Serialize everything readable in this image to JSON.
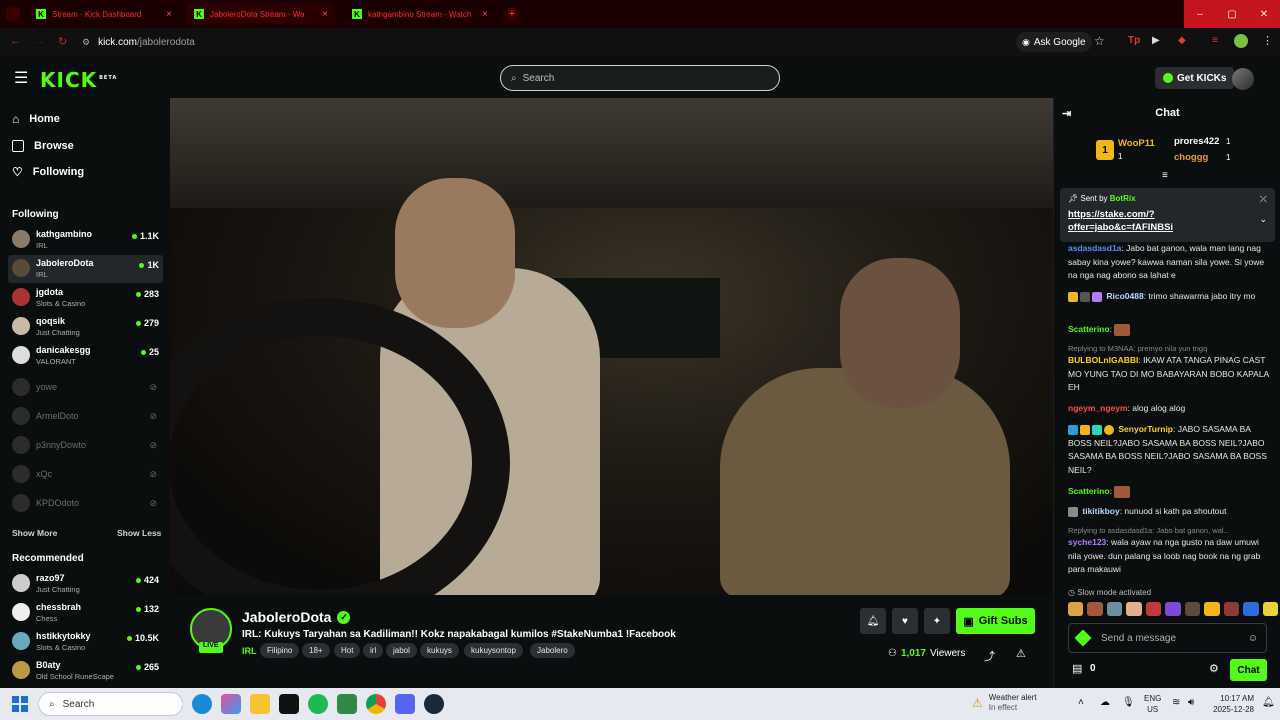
{
  "browser": {
    "tabs": [
      {
        "title": "Stream - Kick Dashboard"
      },
      {
        "title": "JaboleroDota Stream - Wa"
      },
      {
        "title": "kathgambino Stream - Watch"
      }
    ],
    "url_host": "kick.com",
    "url_path": "/jabolerodota",
    "ask_google": "Ask Google"
  },
  "header": {
    "logo": "KICK",
    "logo_badge": "BETA",
    "search_placeholder": "Search",
    "get_kicks": "Get KICKs"
  },
  "sidebar": {
    "nav": [
      {
        "label": "Home",
        "icon": "home-icon"
      },
      {
        "label": "Browse",
        "icon": "browse-icon"
      },
      {
        "label": "Following",
        "icon": "heart-icon"
      }
    ],
    "following_title": "Following",
    "following": [
      {
        "name": "kathgambino",
        "category": "IRL",
        "viewers": "1.1K"
      },
      {
        "name": "JaboleroDota",
        "category": "IRL",
        "viewers": "1K"
      },
      {
        "name": "jgdota",
        "category": "Slots & Casino",
        "viewers": "283"
      },
      {
        "name": "qoqsik",
        "category": "Just Chatting",
        "viewers": "279"
      },
      {
        "name": "danicakesgg",
        "category": "VALORANT",
        "viewers": "25"
      }
    ],
    "offline": [
      {
        "name": "yowe"
      },
      {
        "name": "ArmelDoto"
      },
      {
        "name": "p3nnyDowto"
      },
      {
        "name": "xQc"
      },
      {
        "name": "KPDOdoto"
      }
    ],
    "show_more": "Show More",
    "show_less": "Show Less",
    "recommended_title": "Recommended",
    "recommended": [
      {
        "name": "razo97",
        "category": "Just Chatting",
        "viewers": "424"
      },
      {
        "name": "chessbrah",
        "category": "Chess",
        "viewers": "132"
      },
      {
        "name": "hstikkytokky",
        "category": "Slots & Casino",
        "viewers": "10.5K"
      },
      {
        "name": "B0aty",
        "category": "Old School RuneScape",
        "viewers": "265"
      }
    ]
  },
  "stream": {
    "channel": "JaboleroDota",
    "live": "LIVE",
    "title": "IRL: Kukuys Taryahan sa Kadiliman!! Kokz napakabagal kumilos #StakeNumba1 !Facebook",
    "category": "IRL",
    "tags": [
      "Filipino",
      "18+",
      "Hot",
      "irl",
      "jabol",
      "kukuys",
      "kukuysontop",
      "Jabolero"
    ],
    "viewers": "1,017",
    "viewers_label": "Viewers",
    "gift_subs": "Gift Subs"
  },
  "chat": {
    "title": "Chat",
    "leaderboard": [
      {
        "name": "WooP11",
        "count": "1"
      },
      {
        "name": "prores422",
        "count": "1"
      },
      {
        "name": "choggg",
        "count": "1"
      }
    ],
    "pinned_sent_by": "Sent by",
    "pinned_sender": "BotRix",
    "pinned_link": "https://stake.com/?offer=jabo&c=fAFINBSi",
    "pinned_link_l1": "https://stake.com/?",
    "pinned_link_l2": "offer=jabo&c=fAFINBSi",
    "messages": [
      {
        "user": "asdasdasd1a",
        "text": "Jabo bat ganon, wala man lang nag sabay kina yowe? kawwa naman sila yowe. Si yowe na nga nag abono sa lahat e"
      },
      {
        "user": "Rico0488",
        "text": "trimo shawarma jabo itry mo"
      },
      {
        "user": "Scatterino",
        "text": ""
      },
      {
        "reply": "Replying to M3NAA: premyo nila yun tngq"
      },
      {
        "user": "BULBOLnIGABBI",
        "text": "IKAW ATA TANGA PINAG CAST MO YUNG TAO DI MO BABAYARAN BOBO KAPALA EH"
      },
      {
        "user": "ngeym_ngeym",
        "text": "alog alog alog"
      },
      {
        "user": "SenyorTurnip",
        "text": "JABO SASAMA BA BOSS NEIL?JABO SASAMA BA BOSS NEIL?JABO SASAMA BA BOSS NEIL?JABO SASAMA BA BOSS NEIL?"
      },
      {
        "user": "Scatterino",
        "text": ""
      },
      {
        "user": "tikitikboy",
        "text": "nunuod si kath pa shoutout"
      },
      {
        "reply": "Replying to asdasdasd1a: Jabo bat ganon, wal..."
      },
      {
        "user": "syche123",
        "text": "wala ayaw na nga gusto na daw umuwi nila yowe. dun palang sa loob nag book na ng grab para makauwi"
      }
    ],
    "slow_mode": "Slow mode activated",
    "send_placeholder": "Send a message",
    "kicks_count": "0",
    "chat_button": "Chat"
  },
  "taskbar": {
    "search": "Search",
    "weather_title": "Weather alert",
    "weather_sub": "In effect",
    "lang1": "ENG",
    "lang2": "US",
    "time": "10:17 AM",
    "date": "2025-12-28"
  },
  "colors": {
    "accent": "#53fc18",
    "background": "#0b0e0f"
  }
}
